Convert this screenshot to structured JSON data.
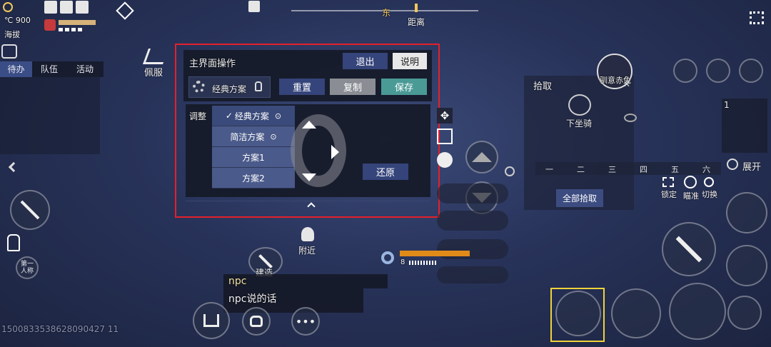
{
  "status": {
    "temperature": "℃ 900",
    "altitude": "海拔"
  },
  "tabs": [
    "待办",
    "队伍",
    "活动"
  ],
  "compass": {
    "direction": "东",
    "distance_label": "距离"
  },
  "top_actions": {
    "wear": "佩服"
  },
  "ui_editor": {
    "title": "主界面操作",
    "exit_label": "退出",
    "help_label": "说明",
    "current_scheme": "经典方案",
    "reset_label": "重置",
    "copy_label": "复制",
    "save_label": "保存",
    "adjust_label": "调整",
    "restore_label": "还原",
    "schemes": [
      "经典方案",
      "简洁方案",
      "方案1",
      "方案2"
    ]
  },
  "pickup_panel": {
    "title": "拾取",
    "dismount_label": "下坐骑",
    "mount_top_label": "驯意赤兔",
    "filters": [
      "一",
      "二",
      "三",
      "四",
      "五",
      "六"
    ],
    "pickup_all_label": "全部拾取"
  },
  "right_controls": {
    "expand_label": "展开",
    "lock_label": "锁定",
    "aim_label": "瞄准",
    "switch_label": "切换",
    "slot_number": "1"
  },
  "left_controls": {
    "first_person_label": "第一\n人称"
  },
  "nearby_label": "附近",
  "build_label": "建造",
  "ammo_count": "8",
  "chat": {
    "speaker": "npc",
    "message": "npc说的话"
  },
  "player_id": "1500833538628090427 11"
}
